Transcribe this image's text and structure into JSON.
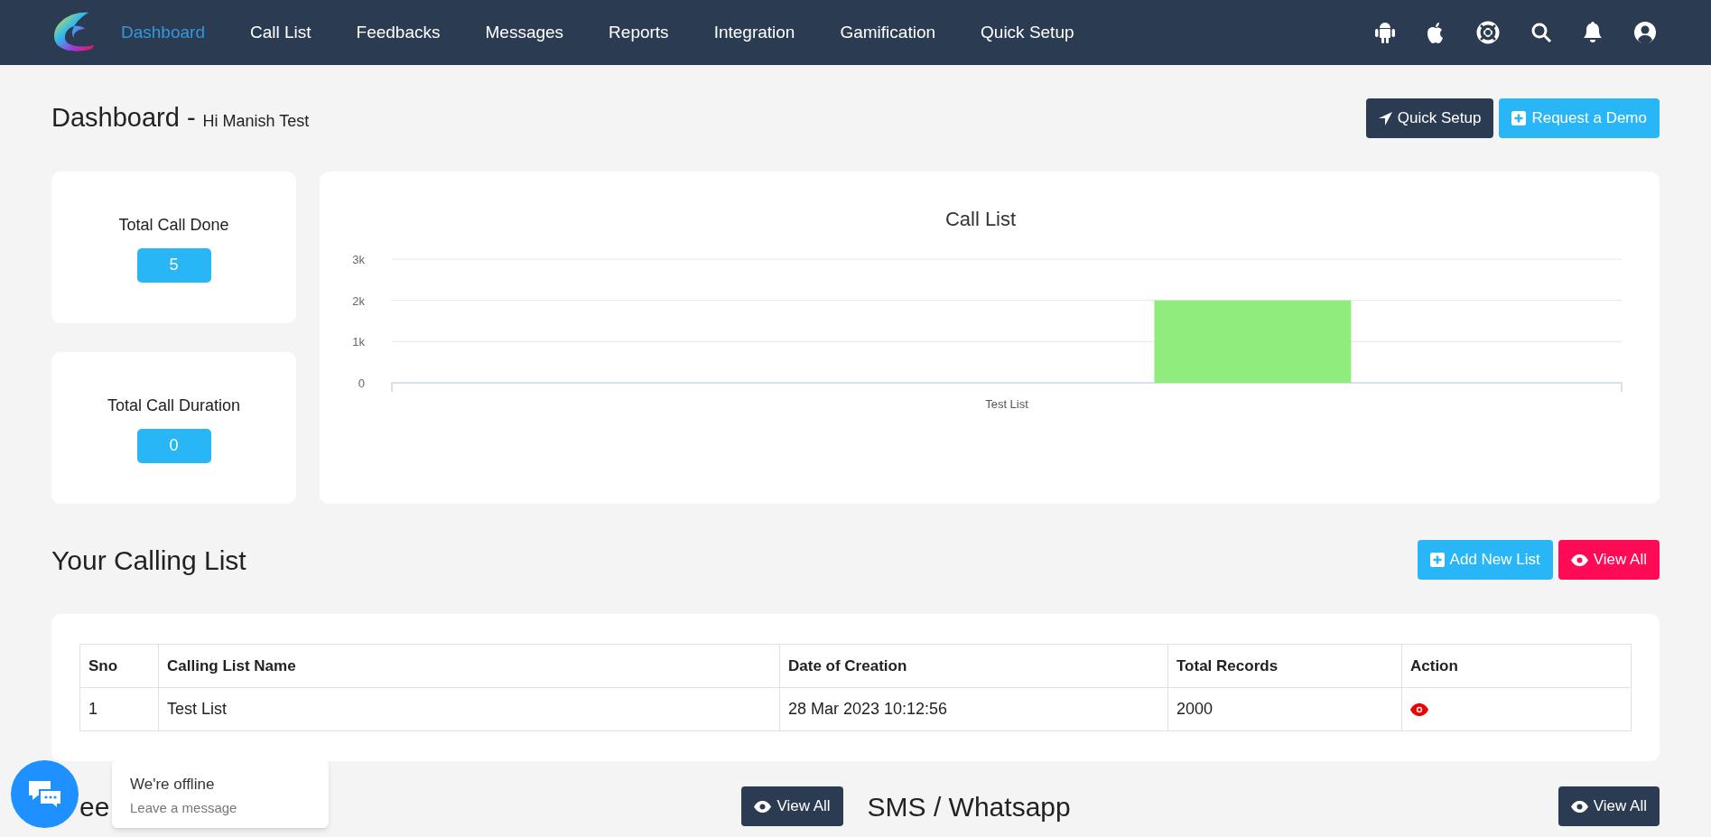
{
  "nav": {
    "items": [
      {
        "label": "Dashboard",
        "selected": true
      },
      {
        "label": "Call List",
        "selected": false
      },
      {
        "label": "Feedbacks",
        "selected": false
      },
      {
        "label": "Messages",
        "selected": false
      },
      {
        "label": "Reports",
        "selected": false
      },
      {
        "label": "Integration",
        "selected": false
      },
      {
        "label": "Gamification",
        "selected": false
      },
      {
        "label": "Quick Setup",
        "selected": false
      }
    ]
  },
  "header": {
    "title": "Dashboard -",
    "greeting": "Hi Manish Test",
    "buttons": [
      {
        "label": "Quick Setup",
        "kind": "dark"
      },
      {
        "label": "Request a Demo",
        "kind": "blue"
      }
    ]
  },
  "stats": [
    {
      "label": "Total Call Done",
      "value": "5"
    },
    {
      "label": "Total Call Duration",
      "value": "0"
    }
  ],
  "chart": {
    "chart_data": {
      "type": "bar",
      "title": "Call List",
      "categories": [
        "Test List"
      ],
      "series": [
        {
          "color": "#90ed7d",
          "values": [
            2000
          ]
        }
      ],
      "ylim": [
        0,
        3000
      ],
      "yticks": [
        {
          "value": 0,
          "label": "0"
        },
        {
          "value": 1000,
          "label": "1k"
        },
        {
          "value": 2000,
          "label": "2k"
        },
        {
          "value": 3000,
          "label": "3k"
        }
      ]
    }
  },
  "calling_list": {
    "title": "Your Calling List",
    "buttons": [
      {
        "label": "Add New List",
        "kind": "blue"
      },
      {
        "label": "View All",
        "kind": "pink"
      }
    ],
    "columns": [
      "Sno",
      "Calling List Name",
      "Date of Creation",
      "Total Records",
      "Action"
    ],
    "rows": [
      [
        "1",
        "Test List",
        "28 Mar 2023 10:12:56",
        "2000"
      ]
    ]
  },
  "bottom": {
    "left_title": "ee",
    "left_button": "View All",
    "right_title": "SMS / Whatsapp",
    "right_button": "View All"
  },
  "chat": {
    "title": "We're offline",
    "subtitle": "Leave a message"
  }
}
